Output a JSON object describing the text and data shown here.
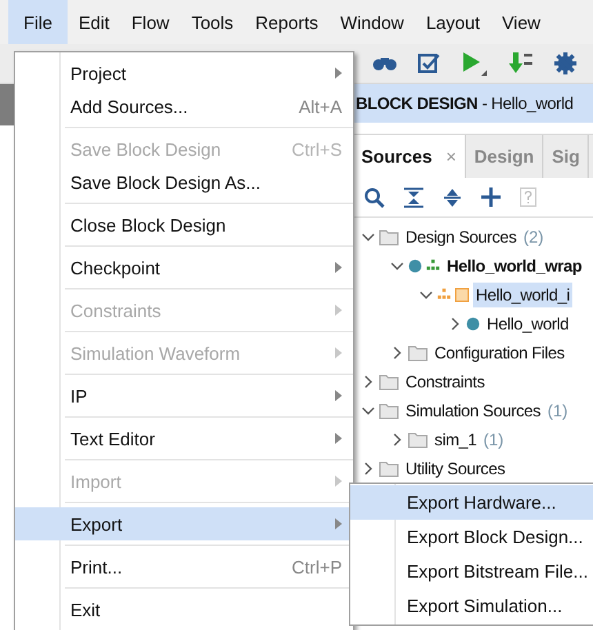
{
  "menubar": [
    {
      "label": "File",
      "selected": true
    },
    {
      "label": "Edit",
      "selected": false
    },
    {
      "label": "Flow",
      "selected": false
    },
    {
      "label": "Tools",
      "selected": false
    },
    {
      "label": "Reports",
      "selected": false
    },
    {
      "label": "Window",
      "selected": false
    },
    {
      "label": "Layout",
      "selected": false
    },
    {
      "label": "View",
      "selected": false
    }
  ],
  "file_menu": [
    [
      {
        "label": "Project",
        "submenu": true,
        "disabled": false,
        "selected": false
      },
      {
        "label": "Add Sources...",
        "shortcut": "Alt+A",
        "submenu": false,
        "disabled": false,
        "selected": false
      }
    ],
    [
      {
        "label": "Save Block Design",
        "shortcut": "Ctrl+S",
        "submenu": false,
        "disabled": true,
        "selected": false
      },
      {
        "label": "Save Block Design As...",
        "submenu": false,
        "disabled": false,
        "selected": false
      }
    ],
    [
      {
        "label": "Close Block Design",
        "submenu": false,
        "disabled": false,
        "selected": false
      }
    ],
    [
      {
        "label": "Checkpoint",
        "submenu": true,
        "disabled": false,
        "selected": false
      }
    ],
    [
      {
        "label": "Constraints",
        "submenu": true,
        "disabled": true,
        "selected": false
      }
    ],
    [
      {
        "label": "Simulation Waveform",
        "submenu": true,
        "disabled": true,
        "selected": false
      }
    ],
    [
      {
        "label": "IP",
        "submenu": true,
        "disabled": false,
        "selected": false
      }
    ],
    [
      {
        "label": "Text Editor",
        "submenu": true,
        "disabled": false,
        "selected": false
      }
    ],
    [
      {
        "label": "Import",
        "submenu": true,
        "disabled": true,
        "selected": false
      }
    ],
    [
      {
        "label": "Export",
        "submenu": true,
        "disabled": false,
        "selected": true
      }
    ],
    [
      {
        "label": "Print...",
        "shortcut": "Ctrl+P",
        "submenu": false,
        "disabled": false,
        "selected": false
      }
    ],
    [
      {
        "label": "Exit",
        "submenu": false,
        "disabled": false,
        "selected": false
      }
    ]
  ],
  "export_submenu": [
    {
      "label": "Export Hardware...",
      "selected": true
    },
    {
      "label": "Export Block Design...",
      "selected": false
    },
    {
      "label": "Export Bitstream File...",
      "selected": false
    },
    {
      "label": "Export Simulation...",
      "selected": false
    }
  ],
  "design_header": {
    "title": "**BLOCK DESIGN** - Hello_world"
  },
  "sources_tabs": [
    {
      "label": "Sources",
      "selected": true,
      "close": "×"
    },
    {
      "label": "Design",
      "selected": false
    },
    {
      "label": "Sig",
      "selected": false
    }
  ],
  "sources_tree": [
    {
      "label": "Design Sources",
      "count": "(2)",
      "kind": "folder",
      "expanded": true,
      "bold": false,
      "selected": false,
      "children": [
        {
          "label": "Hello_world_wrap",
          "kind": "wrapper",
          "expanded": true,
          "bold": true,
          "selected": false,
          "children": [
            {
              "label": "Hello_world_i",
              "kind": "block",
              "expanded": true,
              "bold": false,
              "selected": true,
              "children": [
                {
                  "label": "Hello_world",
                  "kind": "dot",
                  "expanded": false,
                  "bold": false,
                  "selected": false
                }
              ]
            }
          ]
        },
        {
          "label": "Configuration Files",
          "kind": "folder",
          "expanded": false,
          "bold": false,
          "selected": false
        }
      ]
    },
    {
      "label": "Constraints",
      "kind": "folder",
      "expanded": false,
      "bold": false,
      "selected": false
    },
    {
      "label": "Simulation Sources",
      "count": "(1)",
      "kind": "folder",
      "expanded": true,
      "bold": false,
      "selected": false,
      "children": [
        {
          "label": "sim_1",
          "count": "(1)",
          "kind": "folder",
          "expanded": false,
          "bold": false,
          "selected": false
        }
      ]
    },
    {
      "label": "Utility Sources",
      "kind": "folder",
      "expanded": false,
      "bold": false,
      "selected": false
    }
  ]
}
